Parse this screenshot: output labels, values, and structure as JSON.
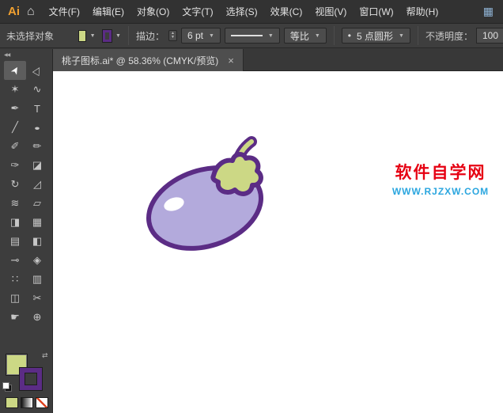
{
  "titlebar": {
    "logo": "Ai",
    "home_glyph": "⌂",
    "workspace_glyph": "▦",
    "menus": [
      "文件(F)",
      "编辑(E)",
      "对象(O)",
      "文字(T)",
      "选择(S)",
      "效果(C)",
      "视图(V)",
      "窗口(W)",
      "帮助(H)"
    ]
  },
  "controlbar": {
    "selection_status": "未选择对象",
    "dropdown_glyph": "▼",
    "stroke_label": "描边：",
    "stepper_up": "▲",
    "stepper_down": "▼",
    "stroke_weight": "6 pt",
    "width_profile": "等比",
    "brush_bullet": "•",
    "brush_name": "5 点圆形",
    "opacity_label": "不透明度：",
    "opacity_value": "100"
  },
  "toolbar": {
    "collapse_glyph": "◀◀",
    "swap_glyph": "⇄",
    "tools": [
      {
        "name": "selection",
        "glyph": "➤"
      },
      {
        "name": "direct-selection",
        "glyph": "▷"
      },
      {
        "name": "magic-wand",
        "glyph": "✶"
      },
      {
        "name": "lasso",
        "glyph": "∿"
      },
      {
        "name": "pen",
        "glyph": "✒"
      },
      {
        "name": "type",
        "glyph": "T"
      },
      {
        "name": "line-segment",
        "glyph": "╱"
      },
      {
        "name": "ellipse",
        "glyph": "●"
      },
      {
        "name": "paintbrush",
        "glyph": "✐"
      },
      {
        "name": "pencil",
        "glyph": "✏"
      },
      {
        "name": "blob-brush",
        "glyph": "✑"
      },
      {
        "name": "eraser",
        "glyph": "◪"
      },
      {
        "name": "rotate",
        "glyph": "↻"
      },
      {
        "name": "scale",
        "glyph": "◿"
      },
      {
        "name": "width",
        "glyph": "≋"
      },
      {
        "name": "free-transform",
        "glyph": "▱"
      },
      {
        "name": "shape-builder",
        "glyph": "◨"
      },
      {
        "name": "perspective-grid",
        "glyph": "▦"
      },
      {
        "name": "mesh",
        "glyph": "▤"
      },
      {
        "name": "gradient",
        "glyph": "◧"
      },
      {
        "name": "eyedropper",
        "glyph": "⊸"
      },
      {
        "name": "blend",
        "glyph": "◈"
      },
      {
        "name": "symbol-sprayer",
        "glyph": "∷"
      },
      {
        "name": "column-graph",
        "glyph": "▥"
      },
      {
        "name": "artboard",
        "glyph": "◫"
      },
      {
        "name": "slice",
        "glyph": "✂"
      },
      {
        "name": "hand",
        "glyph": "☛"
      },
      {
        "name": "zoom",
        "glyph": "⊕"
      }
    ]
  },
  "document": {
    "tab_title": "桃子图标.ai* @ 58.36% (CMYK/预览)",
    "close_glyph": "×"
  },
  "canvas": {
    "watermark_title": "软件自学网",
    "watermark_url": "WWW.RJZXW.COM"
  },
  "colors": {
    "swatch-fill": "#ccd885",
    "swatch-stroke": "#5b2c85",
    "artwork-body": "#b3aadc",
    "artwork-outline": "#5b2c85",
    "leaf-fill": "#ccd885",
    "highlight": "#ffffff",
    "watermark-red": "#e60012",
    "watermark-blue": "#2ba6df"
  }
}
